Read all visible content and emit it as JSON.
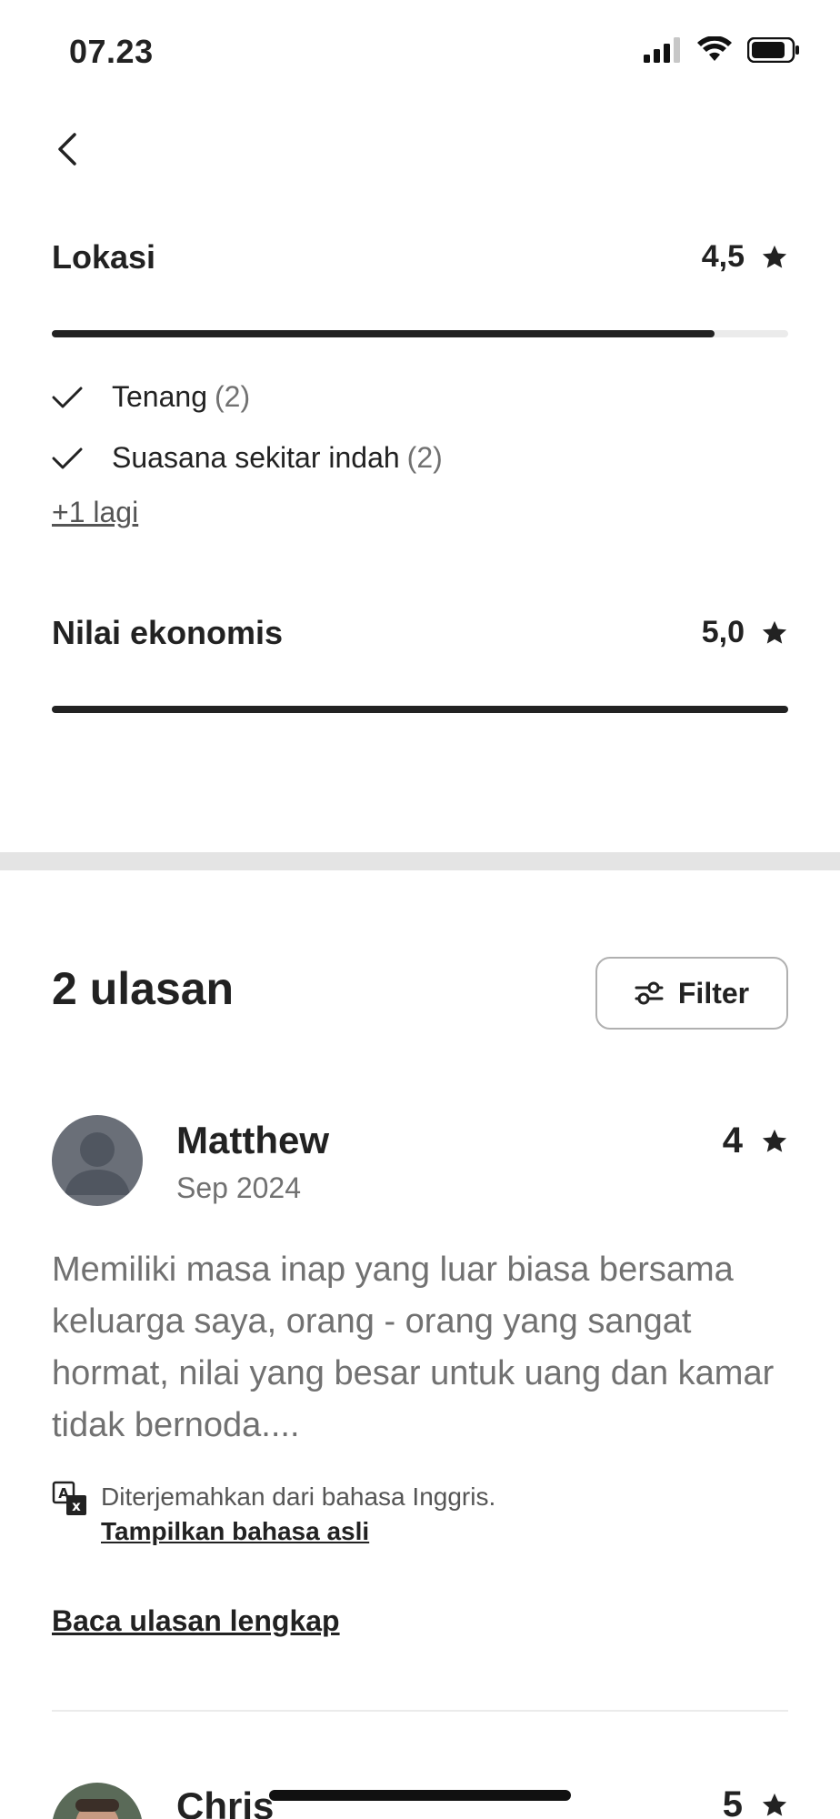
{
  "status_bar": {
    "time": "07.23"
  },
  "categories": [
    {
      "title": "Lokasi",
      "score": "4,5",
      "fill": 0.9,
      "highlights": [
        {
          "label": "Tenang",
          "count": "(2)"
        },
        {
          "label": "Suasana sekitar indah",
          "count": "(2)"
        }
      ],
      "more": "+1 lagi"
    },
    {
      "title": "Nilai ekonomis",
      "score": "5,0",
      "fill": 1.0
    }
  ],
  "reviews_header": {
    "count_label": "2 ulasan",
    "filter_label": "Filter"
  },
  "reviews": [
    {
      "name": "Matthew",
      "date": "Sep 2024",
      "rating": "4",
      "text": "Memiliki masa inap yang luar biasa bersama keluarga saya, orang - orang yang sangat hormat, nilai yang besar untuk uang dan kamar tidak bernoda....",
      "translation_note": "Diterjemahkan dari bahasa Inggris.",
      "show_original": "Tampilkan bahasa asli",
      "read_full": "Baca ulasan lengkap"
    },
    {
      "name": "Chris",
      "rating": "5"
    }
  ],
  "icons": {
    "back": "chevron-left-icon",
    "star": "star-icon",
    "check": "check-icon",
    "filter": "sliders-icon",
    "translate": "translate-icon"
  }
}
